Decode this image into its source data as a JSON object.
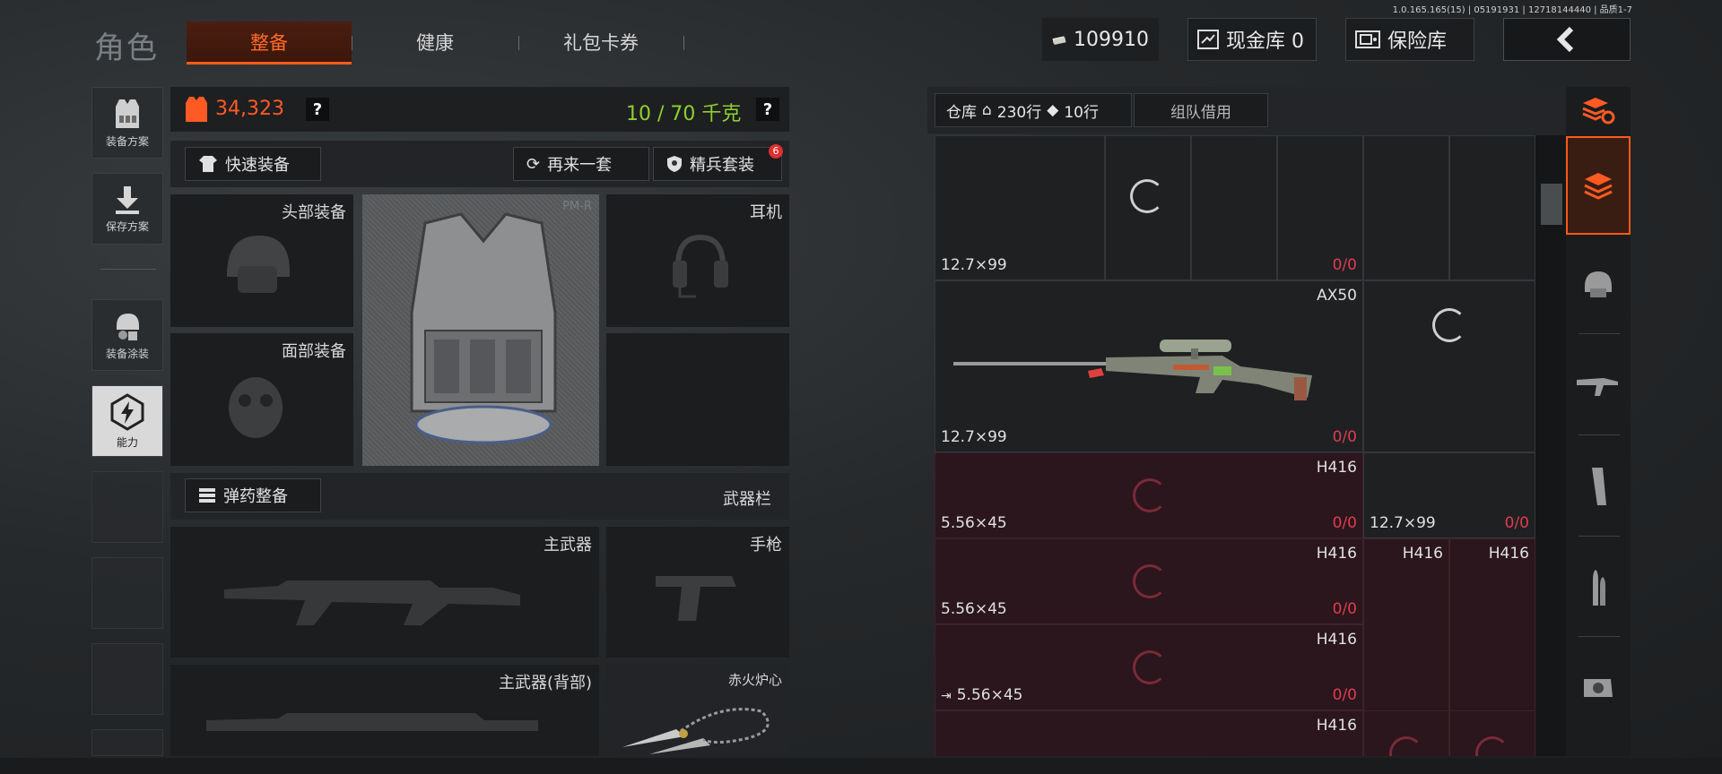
{
  "version": "1.0.165.165(15) | 05191931 | 12718144440 | 品质1-7",
  "header": {
    "title": "角色",
    "tabs": [
      {
        "label": "整备",
        "active": true
      },
      {
        "label": "健康",
        "active": false
      },
      {
        "label": "礼包卡券",
        "active": false
      }
    ],
    "money": "109910",
    "cash_vault": "现金库 0",
    "safe": "保险库"
  },
  "sidebar": {
    "items": [
      {
        "label": "装备方案",
        "icon": "vest-icon"
      },
      {
        "label": "保存方案",
        "icon": "download-icon"
      },
      {
        "label": "装备涂装",
        "icon": "helmet-paint-icon"
      },
      {
        "label": "能力",
        "icon": "ability-icon",
        "active": true
      }
    ]
  },
  "loadout": {
    "value": "34,323",
    "weight": "10 / 70 千克",
    "help": "?",
    "quick_equip": "快速装备",
    "again": "再来一套",
    "elite": "精兵套装",
    "elite_badge": "6",
    "slots": {
      "head": "头部装备",
      "armor_model": "PM-R",
      "earphone": "耳机",
      "face": "面部装备"
    },
    "ammo_button": "弹药整备",
    "weapon_bar": "武器栏",
    "primary": "主武器",
    "pistol": "手枪",
    "primary_back": "主武器(背部)",
    "melee": "赤火炉心"
  },
  "warehouse": {
    "tab_label": "仓库",
    "rows_house": "230行",
    "rows_ext": "10行",
    "team_tab": "组队借用",
    "cells": {
      "c1_cal": "12.7×99",
      "c1_cnt_a": "0",
      "c1_cnt_b": "0",
      "c2_name": "AX50",
      "c2_cal": "12.7×99",
      "c2_cnt_a": "0",
      "c2_cnt_b": "0",
      "c3_name": "H416",
      "c3_cal": "5.56×45",
      "c3_cnt_a": "0",
      "c3_cnt_b": "0",
      "c4_cal": "12.7×99",
      "c4_cnt_a": "0",
      "c4_cnt_b": "0",
      "c5_name": "H416",
      "c5_cal": "5.56×45",
      "c5_cnt_a": "0",
      "c5_cnt_b": "0",
      "c6_name": "H416",
      "c7_name": "H416",
      "c8_name": "H416",
      "c8_cal": "5.56×45",
      "c8_cnt_a": "0",
      "c8_cnt_b": "0",
      "c9_name": "H416"
    },
    "count_sep": "/"
  }
}
